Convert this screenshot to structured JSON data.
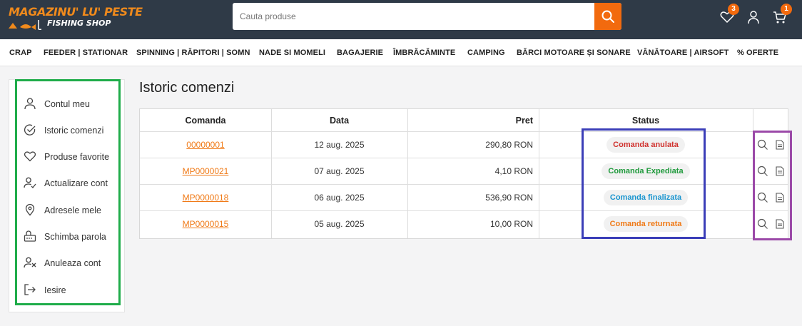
{
  "header": {
    "logo": {
      "line1": "MAGAZINU' LU' PESTE",
      "line2": "FISHING SHOP"
    },
    "search": {
      "placeholder": "Cauta produse"
    },
    "wishlist_count": "3",
    "cart_count": "1"
  },
  "nav": [
    "CRAP",
    "FEEDER | STATIONAR",
    "SPINNING | RĂPITORI | SOMN",
    "NADE SI MOMELI",
    "BAGAJERIE",
    "ÎMBRĂCĂMINTE",
    "CAMPING",
    "BĂRCI MOTOARE ȘI SONARE",
    "VÂNĂTOARE | AIRSOFT",
    "% OFERTE"
  ],
  "sidebar": {
    "items": [
      {
        "label": "Contul meu",
        "icon": "user-icon"
      },
      {
        "label": "Istoric comenzi",
        "icon": "check-circle-icon"
      },
      {
        "label": "Produse favorite",
        "icon": "heart-icon"
      },
      {
        "label": "Actualizare cont",
        "icon": "user-check-icon"
      },
      {
        "label": "Adresele mele",
        "icon": "map-pin-icon"
      },
      {
        "label": "Schimba parola",
        "icon": "password-icon"
      },
      {
        "label": "Anuleaza cont",
        "icon": "user-x-icon"
      },
      {
        "label": "Iesire",
        "icon": "logout-icon"
      }
    ]
  },
  "page": {
    "title": "Istoric comenzi"
  },
  "orders": {
    "headers": [
      "Comanda",
      "Data",
      "Pret",
      "Status",
      ""
    ],
    "rows": [
      {
        "id": "00000001",
        "date": "12 aug. 2025",
        "price": "290,80 RON",
        "status": "Comanda anulata",
        "status_color": "#d0312d"
      },
      {
        "id": "MP0000021",
        "date": "07 aug. 2025",
        "price": "4,10 RON",
        "status": "Comanda Expediata",
        "status_color": "#1f9a3c"
      },
      {
        "id": "MP0000018",
        "date": "06 aug. 2025",
        "price": "536,90 RON",
        "status": "Comanda finalizata",
        "status_color": "#1a95cf"
      },
      {
        "id": "MP0000015",
        "date": "05 aug. 2025",
        "price": "10,00 RON",
        "status": "Comanda returnata",
        "status_color": "#f07a17"
      }
    ]
  },
  "colors": {
    "accent": "#f26a0e",
    "header_bg": "#2f3a47",
    "highlight_green": "#1fac4a",
    "highlight_blue": "#3b3eb8",
    "highlight_purple": "#9b49a8"
  }
}
